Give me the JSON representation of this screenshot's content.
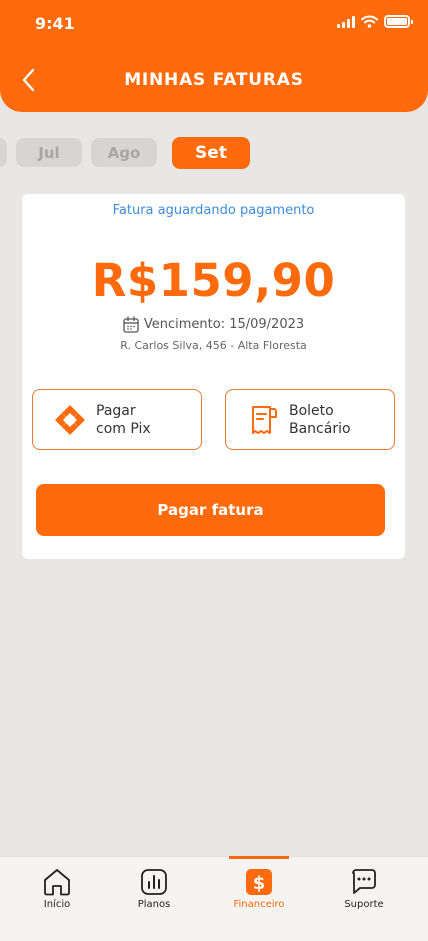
{
  "status_bar": {
    "time": "9:41"
  },
  "header": {
    "title": "MINHAS FATURAS"
  },
  "months": [
    {
      "label": ""
    },
    {
      "label": "Jul"
    },
    {
      "label": "Ago"
    },
    {
      "label": "Set",
      "active": true
    }
  ],
  "invoice": {
    "status": "Fatura aguardando pagamento",
    "amount": "R$159,90",
    "due_label": "Vencimento: 15/09/2023",
    "address": "R. Carlos Silva, 456 - Alta Floresta"
  },
  "payment_options": {
    "pix": {
      "line1": "Pagar",
      "line2": "com Pix"
    },
    "boleto": {
      "line1": "Boleto",
      "line2": "Bancário"
    }
  },
  "pay_button": "Pagar fatura",
  "bottom_nav": {
    "items": [
      {
        "label": "Início",
        "icon": "home-icon"
      },
      {
        "label": "Planos",
        "icon": "chart-icon"
      },
      {
        "label": "Financeiro",
        "icon": "dollar-icon",
        "active": true
      },
      {
        "label": "Suporte",
        "icon": "chat-icon"
      }
    ]
  },
  "colors": {
    "accent": "#ff6a0d",
    "status_text": "#3d8ce0",
    "background": "#e8e7e5"
  }
}
